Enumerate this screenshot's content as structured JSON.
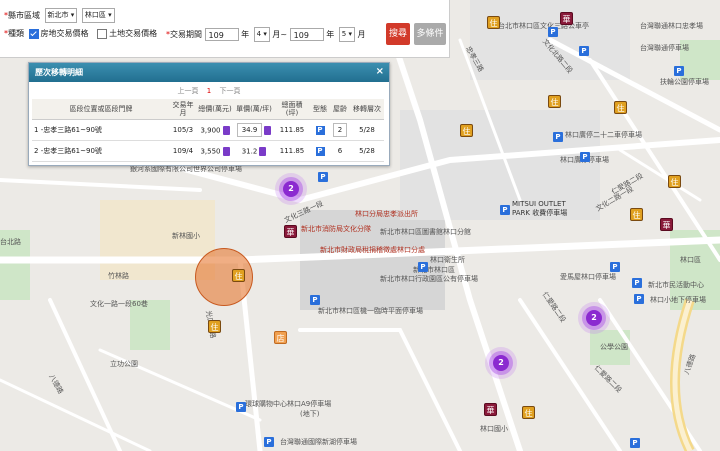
{
  "filter": {
    "region_label": "縣市區域",
    "city": "新北市",
    "district": "林口區",
    "type_label": "種類",
    "type_house": "房地交易價格",
    "type_land": "土地交易價格",
    "period_label": "交易期間",
    "start_year": "109",
    "start_month": "4",
    "end_year": "109",
    "end_month": "5",
    "year_unit": "年",
    "month_sep": "月~",
    "month_unit": "月",
    "search_button": "搜尋",
    "more_button": "多條件"
  },
  "popup": {
    "title": "歷次移轉明細",
    "close": "×",
    "prev": "上一頁",
    "page": "1",
    "next": "下一頁",
    "headers": [
      "區段位置或區段門牌",
      "交易年月",
      "總價(萬元)",
      "單價(萬/坪)",
      "總面積(坪)",
      "型態",
      "屋齡",
      "移轉層次"
    ],
    "rows": [
      {
        "no": "1",
        "addr": "-忠孝三路61~90號",
        "ym": "105/3",
        "total": "3,900",
        "unit": "34.9",
        "area": "111.85",
        "floors": "2",
        "level": "5/28"
      },
      {
        "no": "2",
        "addr": "-忠孝三路61~90號",
        "ym": "109/4",
        "total": "3,550",
        "unit": "31.2",
        "area": "111.85",
        "floors": "6",
        "level": "5/28"
      }
    ]
  },
  "map": {
    "labels": {
      "l1": "台北市林口區文化三路公車亭",
      "l2": "台灣聯通林口忠孝場",
      "l3": "台灣聯通停車場",
      "l4": "扶輪公園停車場",
      "l5": "林口廣停二十二車停車場",
      "l6": "林口廣停停車場",
      "l7": "MITSUI OUTLET PARK 收費停車場",
      "l8": "林口分局忠孝派出所",
      "l9": "新北市消防局文化分隊",
      "l10": "新北市林口區圖書館林口分館",
      "l11": "新北市財政局稅捐稽徵處林口分處",
      "l12": "林口衛生所",
      "l13": "新北市林口區",
      "l14": "新北市林口行政園區公有停車場",
      "l15": "新北市林口區機一臨時平面停車場",
      "l16": "銀河系國際有限公司世界公司停車場",
      "l17": "新林國小",
      "l18": "竹林路",
      "l19": "文化一路一段60巷",
      "l20": "立功公園",
      "l21": "文化三路一段",
      "l22": "環球購物中心林口A9停車場",
      "l23": "(地下)",
      "l24": "台灣聯通國際新湖停車場",
      "l25": "文化二路一段",
      "l26": "仁愛路二段",
      "l27": "林口區",
      "l28": "愛馬屋林口停車場",
      "l29": "仁愛路二段",
      "l30": "新北市民活動中心",
      "l31": "林口小地下停車場",
      "l32": "八德路",
      "l33": "公學公園",
      "l34": "仁愛路二段",
      "l35": "林口國小",
      "l36": "八德路",
      "l37": "光口四路",
      "l38": "台北路",
      "l39": "文化北路二段",
      "l40": "忠孝三路"
    },
    "clusters": [
      "2",
      "2",
      "2"
    ],
    "pin_house": "住",
    "pin_shop": "店",
    "pin_other": "華",
    "park": "P"
  },
  "colors": {
    "accent": "#d23a2a",
    "title_bar": "#2b7fa2",
    "cluster": "#8b2ad0",
    "pin": "#e0a020"
  }
}
